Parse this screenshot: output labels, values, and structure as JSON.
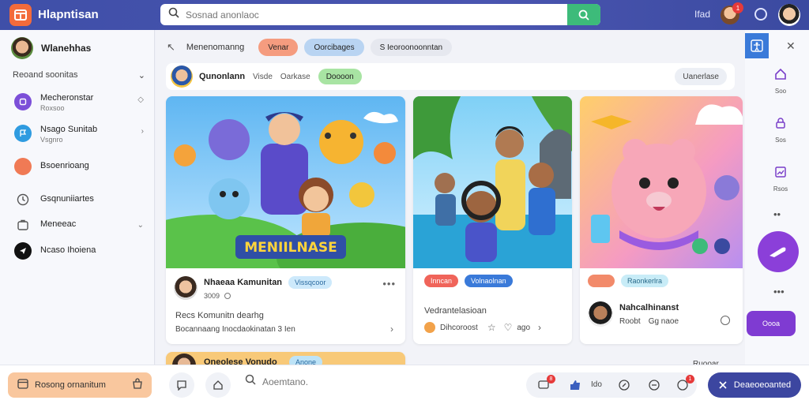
{
  "app": {
    "title": "Hlapntisan"
  },
  "search": {
    "placeholder": "Sosnad anonlaoc"
  },
  "topbar": {
    "label": "Ifad",
    "badge": "1"
  },
  "sidebar": {
    "username": "Wlanehhas",
    "section": "Reoand soonitas",
    "items": [
      {
        "label": "Mecheronstar",
        "sub": "Roxsoo",
        "icon": "bookmark-icon",
        "color": "#7c4fd8"
      },
      {
        "label": "Nsago Sunitab",
        "sub": "Vsgnro",
        "icon": "flag-icon",
        "color": "#2f9be0"
      },
      {
        "label": "Bsoenrioang",
        "sub": "",
        "icon": "circle-icon",
        "color": "#f07a55"
      },
      {
        "label": "Gsqnuniiartes",
        "sub": "",
        "icon": "clock-icon",
        "color": "#555555"
      },
      {
        "label": "Meneeac",
        "sub": "",
        "icon": "briefcase-icon",
        "color": "#555555"
      },
      {
        "label": "Ncaso Ihoiena",
        "sub": "",
        "icon": "send-icon",
        "color": "#111111"
      }
    ]
  },
  "filters": {
    "label": "Menenomanng",
    "chips": [
      "Venar",
      "Oorcibages",
      "S Ieoroonoonntan"
    ]
  },
  "context": {
    "name": "Qunonlann",
    "text1": "Visde",
    "text2": "Oarkase",
    "chip": "Doooon",
    "button": "Uanerlase"
  },
  "cards": [
    {
      "banner": "MENIILNASE",
      "author": "Nhaeaa Kamunitan",
      "tag": "Vissqcoor",
      "date": "3009",
      "line1": "Recs Komunitn dearhg",
      "line2": "Bocannaang  Inocdaokinatan 3 Ien"
    },
    {
      "tag1": "Inncan",
      "tag2": "Volnaolnan",
      "text": "Vedrantelasioan",
      "meta": "Dihcoroost",
      "meta2": "ago"
    },
    {
      "tag1": "Raonkerlra",
      "name": "Nahcalhinanst",
      "meta": "Roobt",
      "meta2": "Gg naoe"
    }
  ],
  "rail": {
    "labels": [
      "Soo",
      "Sos",
      "Rsos"
    ],
    "button": "Oooa"
  },
  "bottom": {
    "left_label": "Rosong ornanitum",
    "search_placeholder": "Aoemtano.",
    "group_label": "Ido",
    "badge1": "8",
    "badge2": "1",
    "cta": "Deaeoeoanted"
  },
  "lower_cards": {
    "name": "Oneolese Vonudo",
    "tag": "Anone",
    "right": "Ruooar"
  },
  "colors": {
    "brand": "#3f4fa8",
    "accent": "#8b3fd9",
    "orange": "#f36b3b",
    "green": "#3dbb7a"
  }
}
